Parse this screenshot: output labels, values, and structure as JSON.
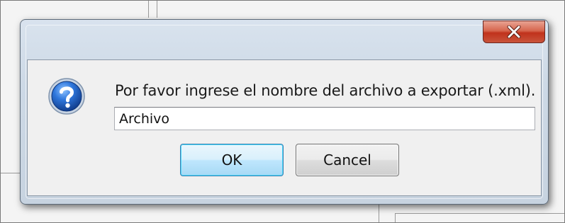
{
  "dialog": {
    "close_icon": "close-x-icon",
    "message_icon": "question-icon",
    "message": "Por favor ingrese el nombre del archivo a exportar (.xml).",
    "input_value": "Archivo",
    "ok_label": "OK",
    "cancel_label": "Cancel"
  },
  "colors": {
    "close_button": "#c9462e",
    "ok_button_border": "#3c7fb1",
    "icon_blue": "#1f5fbf"
  }
}
